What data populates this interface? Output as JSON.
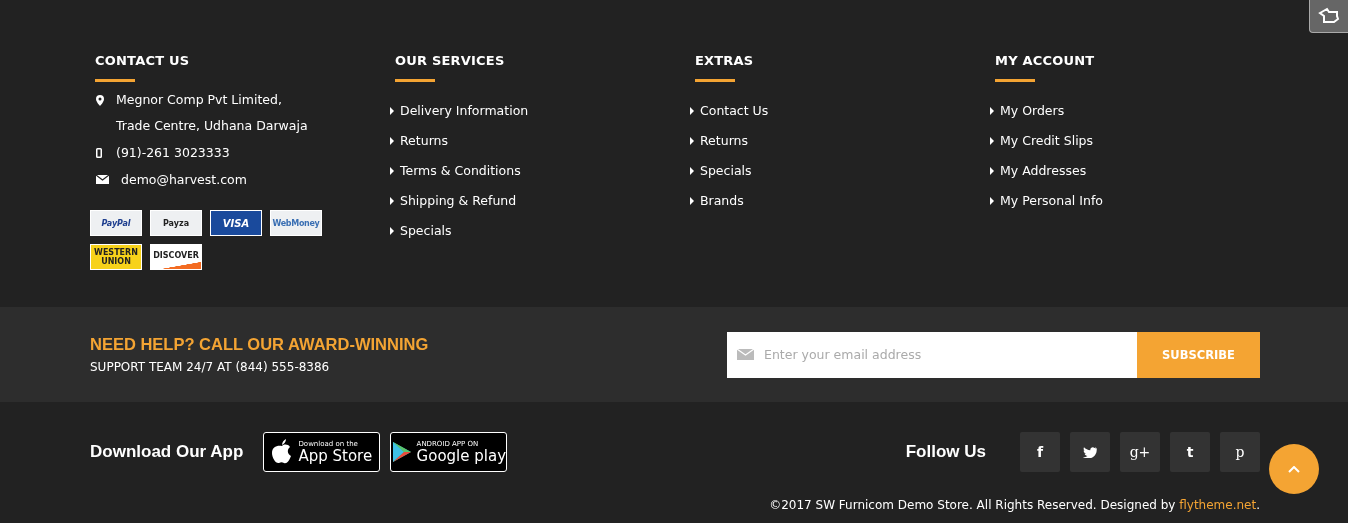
{
  "contact": {
    "title": "CONTACT US",
    "items": [
      {
        "kind": "address",
        "lines": [
          "Megnor Comp Pvt Limited,",
          "Trade Centre, Udhana Darwaja"
        ]
      },
      {
        "kind": "phone",
        "lines": [
          "(91)-261 3023333"
        ]
      },
      {
        "kind": "email",
        "lines": [
          "demo@harvest.com"
        ]
      }
    ],
    "payments": [
      {
        "kind": "paypal",
        "label": "PayPal"
      },
      {
        "kind": "payza",
        "label": "Payza"
      },
      {
        "kind": "visa",
        "label": "VISA"
      },
      {
        "kind": "webmoney",
        "label": "WebMoney"
      },
      {
        "kind": "western",
        "label": "WESTERN UNION"
      },
      {
        "kind": "discover",
        "label": "DISCOVER"
      }
    ]
  },
  "link_columns": [
    {
      "title": "OUR SERVICES",
      "links": [
        "Delivery Information",
        "Returns",
        "Terms & Conditions",
        "Shipping & Refund",
        "Specials"
      ]
    },
    {
      "title": "EXTRAS",
      "links": [
        "Contact Us",
        "Returns",
        "Specials",
        "Brands"
      ]
    },
    {
      "title": "MY ACCOUNT",
      "links": [
        "My Orders",
        "My Credit Slips",
        "My Addresses",
        "My Personal Info"
      ]
    }
  ],
  "help": {
    "heading": "NEED HELP? CALL OUR AWARD-WINNING",
    "subtext": "SUPPORT TEAM 24/7 AT (844) 555-8386"
  },
  "newsletter": {
    "placeholder": "Enter your email address",
    "button": "SUBSCRIBE"
  },
  "app": {
    "title": "Download Our App",
    "badges": [
      {
        "kind": "apple",
        "small": "Download on the",
        "big": "App Store"
      },
      {
        "kind": "google",
        "small": "ANDROID APP ON",
        "big": "Google play"
      }
    ]
  },
  "follow": {
    "title": "Follow Us",
    "icons": [
      {
        "kind": "facebook",
        "glyph": "f"
      },
      {
        "kind": "twitter"
      },
      {
        "kind": "googleplus",
        "glyph": "g+"
      },
      {
        "kind": "tumblr",
        "glyph": "t"
      },
      {
        "kind": "pinterest",
        "glyph": "p"
      }
    ]
  },
  "copyright": {
    "text": "©2017 SW Furnicom Demo Store. All Rights Reserved. Designed by ",
    "link": "flytheme.net",
    "end": "."
  }
}
